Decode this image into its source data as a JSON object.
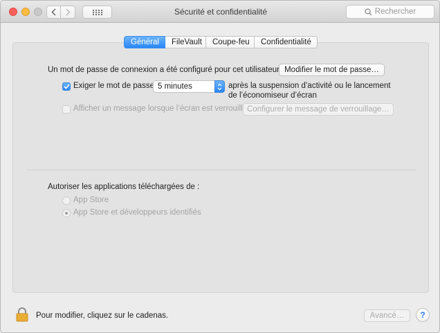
{
  "window": {
    "title": "Sécurité et confidentialité",
    "search_placeholder": "Rechercher"
  },
  "tabs": [
    {
      "label": "Général",
      "active": true
    },
    {
      "label": "FileVault",
      "active": false
    },
    {
      "label": "Coupe-feu",
      "active": false
    },
    {
      "label": "Confidentialité",
      "active": false
    }
  ],
  "general": {
    "password_set_text": "Un mot de passe de connexion a été configuré pour cet utilisateur",
    "change_password_button": "Modifier le mot de passe…",
    "require_password": {
      "label": "Exiger le mot de passe",
      "checked": true,
      "delay_value": "5 minutes",
      "after_text_line1": "après la suspension d’activité ou le lancement",
      "after_text_line2": "de l’économiseur d’écran"
    },
    "lock_message": {
      "label": "Afficher un message lorsque l’écran est verrouillé",
      "checked": false,
      "enabled": false,
      "button": "Configurer le message de verrouillage…"
    },
    "allow_apps": {
      "heading": "Autoriser les applications téléchargées de :",
      "options": [
        {
          "label": "App Store",
          "selected": false
        },
        {
          "label": "App Store et développeurs identifiés",
          "selected": true
        }
      ]
    }
  },
  "footer": {
    "lock_text": "Pour modifier, cliquez sur le cadenas.",
    "advanced_button": "Avancé…",
    "help_label": "?"
  },
  "colors": {
    "accent": "#2987f7",
    "close": "#fc605c",
    "minimize": "#fdbc40"
  }
}
